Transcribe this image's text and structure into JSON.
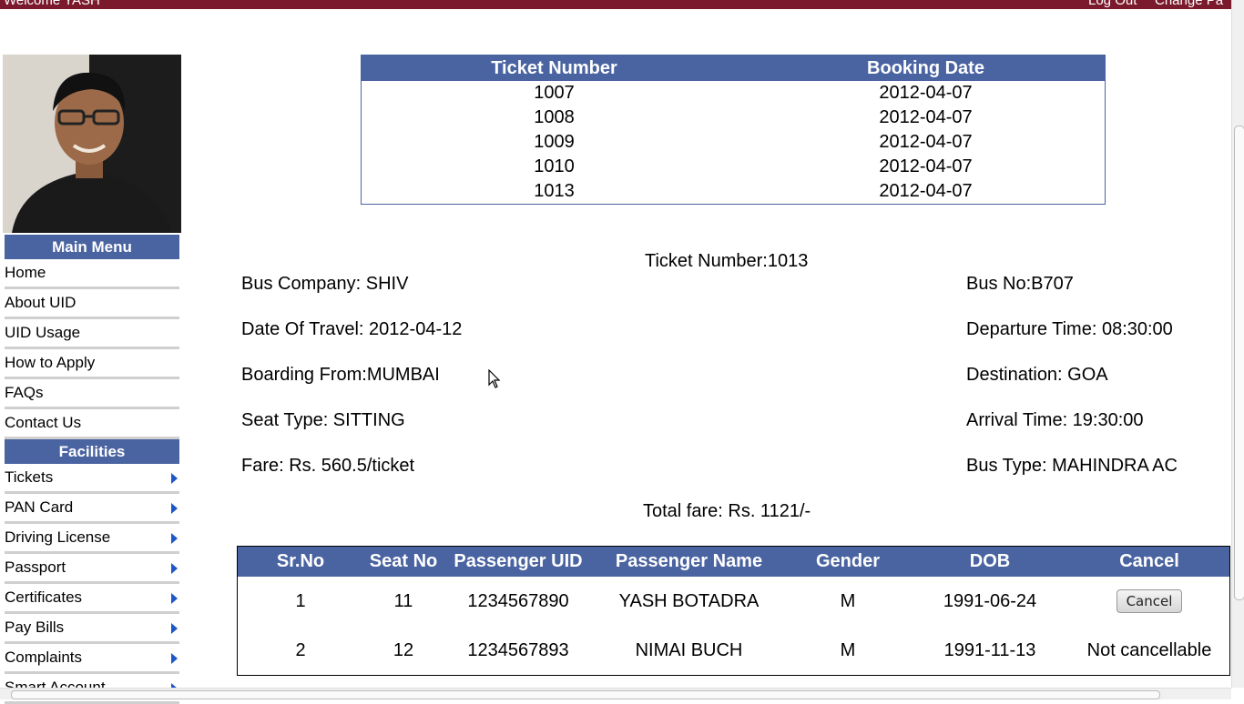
{
  "topbar": {
    "welcome": "Welcome YASH",
    "logout": "Log Out",
    "change_password": "Change Pa"
  },
  "sidebar": {
    "main_menu_title": "Main Menu",
    "main_items": [
      "Home",
      "About UID",
      "UID Usage",
      "How to Apply",
      "FAQs",
      "Contact Us"
    ],
    "facilities_title": "Facilities",
    "facility_items": [
      "Tickets",
      "PAN Card",
      "Driving License",
      "Passport",
      "Certificates",
      "Pay Bills",
      "Complaints",
      "Smart Account"
    ]
  },
  "tickets": {
    "headers": [
      "Ticket Number",
      "Booking Date"
    ],
    "rows": [
      [
        "1007",
        "2012-04-07"
      ],
      [
        "1008",
        "2012-04-07"
      ],
      [
        "1009",
        "2012-04-07"
      ],
      [
        "1010",
        "2012-04-07"
      ],
      [
        "1013",
        "2012-04-07"
      ]
    ]
  },
  "details": {
    "ticket_number": "Ticket Number:1013",
    "bus_company": "Bus Company: SHIV",
    "bus_no": "Bus No:B707",
    "date_of_travel": "Date Of Travel: 2012-04-12",
    "departure_time": "Departure Time: 08:30:00",
    "boarding_from": "Boarding From:MUMBAI",
    "destination": "Destination: GOA",
    "seat_type": "Seat Type: SITTING",
    "arrival_time": "Arrival Time: 19:30:00",
    "fare": "Fare: Rs. 560.5/ticket",
    "bus_type": "Bus Type: MAHINDRA AC",
    "total_fare": "Total fare: Rs. 1121/-"
  },
  "passengers": {
    "headers": [
      "Sr.No",
      "Seat No",
      "Passenger UID",
      "Passenger Name",
      "Gender",
      "DOB",
      "Cancel"
    ],
    "rows": [
      {
        "sr": "1",
        "seat": "11",
        "uid": "1234567890",
        "name": "YASH BOTADRA",
        "gender": "M",
        "dob": "1991-06-24",
        "cancel": "Cancel"
      },
      {
        "sr": "2",
        "seat": "12",
        "uid": "1234567893",
        "name": "NIMAI BUCH",
        "gender": "M",
        "dob": "1991-11-13",
        "cancel": "Not cancellable"
      }
    ]
  },
  "colors": {
    "header_blue": "#4a63a1",
    "topbar": "#7a1a2c",
    "menu_arrow": "#1e56c8"
  }
}
